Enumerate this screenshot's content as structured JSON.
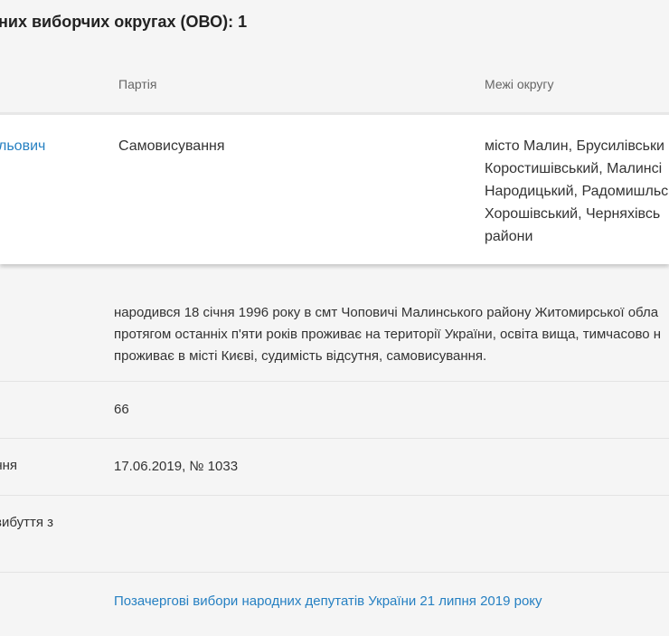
{
  "header": {
    "title": "них виборчих округах (ОВО): 1"
  },
  "table": {
    "columns": {
      "party": "Партія",
      "boundaries": "Межі округу"
    },
    "row": {
      "candidate_name": "льович",
      "party": "Самовисування",
      "boundaries_lines": [
        "місто Малин, Брусилівськи",
        "Коростишівський, Малинсі",
        "Народицький, Радомишльс",
        "Хорошівський, Черняхівсь",
        "райони"
      ]
    }
  },
  "details": {
    "bio_lines": [
      "народився 18 січня 1996 року в смт Чоповичі Малинського району Житомирської обла",
      "протягом останніх п'яти років проживає на території України, освіта вища, тимчасово н",
      "проживає в місті Києві, судимість відсутня, самовисування."
    ],
    "number_value": "66",
    "registration_label": "ання",
    "registration_value": "17.06.2019, № 1033",
    "dropout_label": "вибуття з",
    "election_link": "Позачергові вибори народних депутатів України 21 липня 2019 року"
  }
}
